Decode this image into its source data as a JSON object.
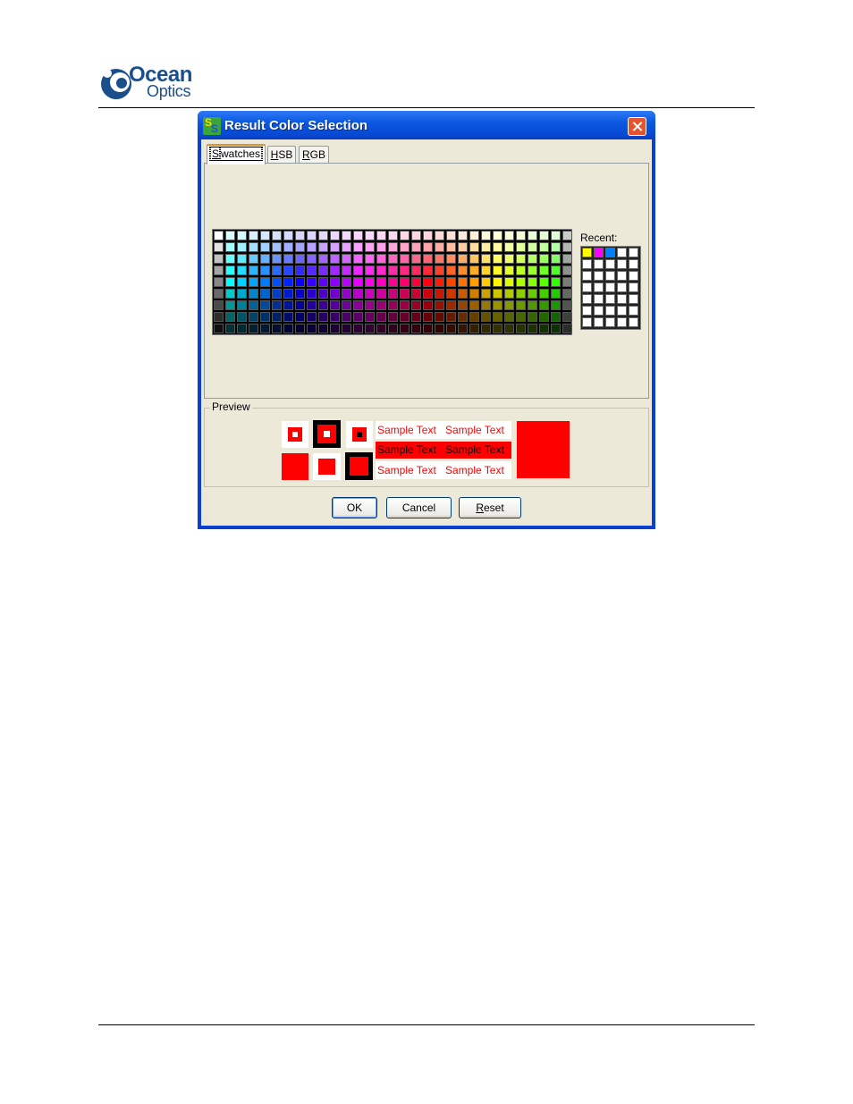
{
  "header": {
    "logo_line1": "Ocean",
    "logo_line2": "Optics"
  },
  "dialog": {
    "title": "Result Color Selection",
    "icon": "app-ss-icon",
    "close_icon": "close-icon",
    "tabs": [
      {
        "label": "Swatches",
        "mnemonic": "S",
        "rest": "watches",
        "active": true
      },
      {
        "label": "HSB",
        "mnemonic": "H",
        "rest": "SB",
        "active": false
      },
      {
        "label": "RGB",
        "mnemonic": "R",
        "rest": "GB",
        "active": false
      }
    ],
    "recent_label": "Recent:",
    "recent_colors": [
      "#ffff00",
      "#ff00ff",
      "#0080ff"
    ],
    "preview_label": "Preview",
    "preview_color": "#ff0000",
    "sample_text": "Sample Text",
    "buttons": {
      "ok": "OK",
      "cancel": "Cancel",
      "reset": "Reset",
      "reset_mnemonic": "R",
      "reset_rest": "eset"
    }
  }
}
